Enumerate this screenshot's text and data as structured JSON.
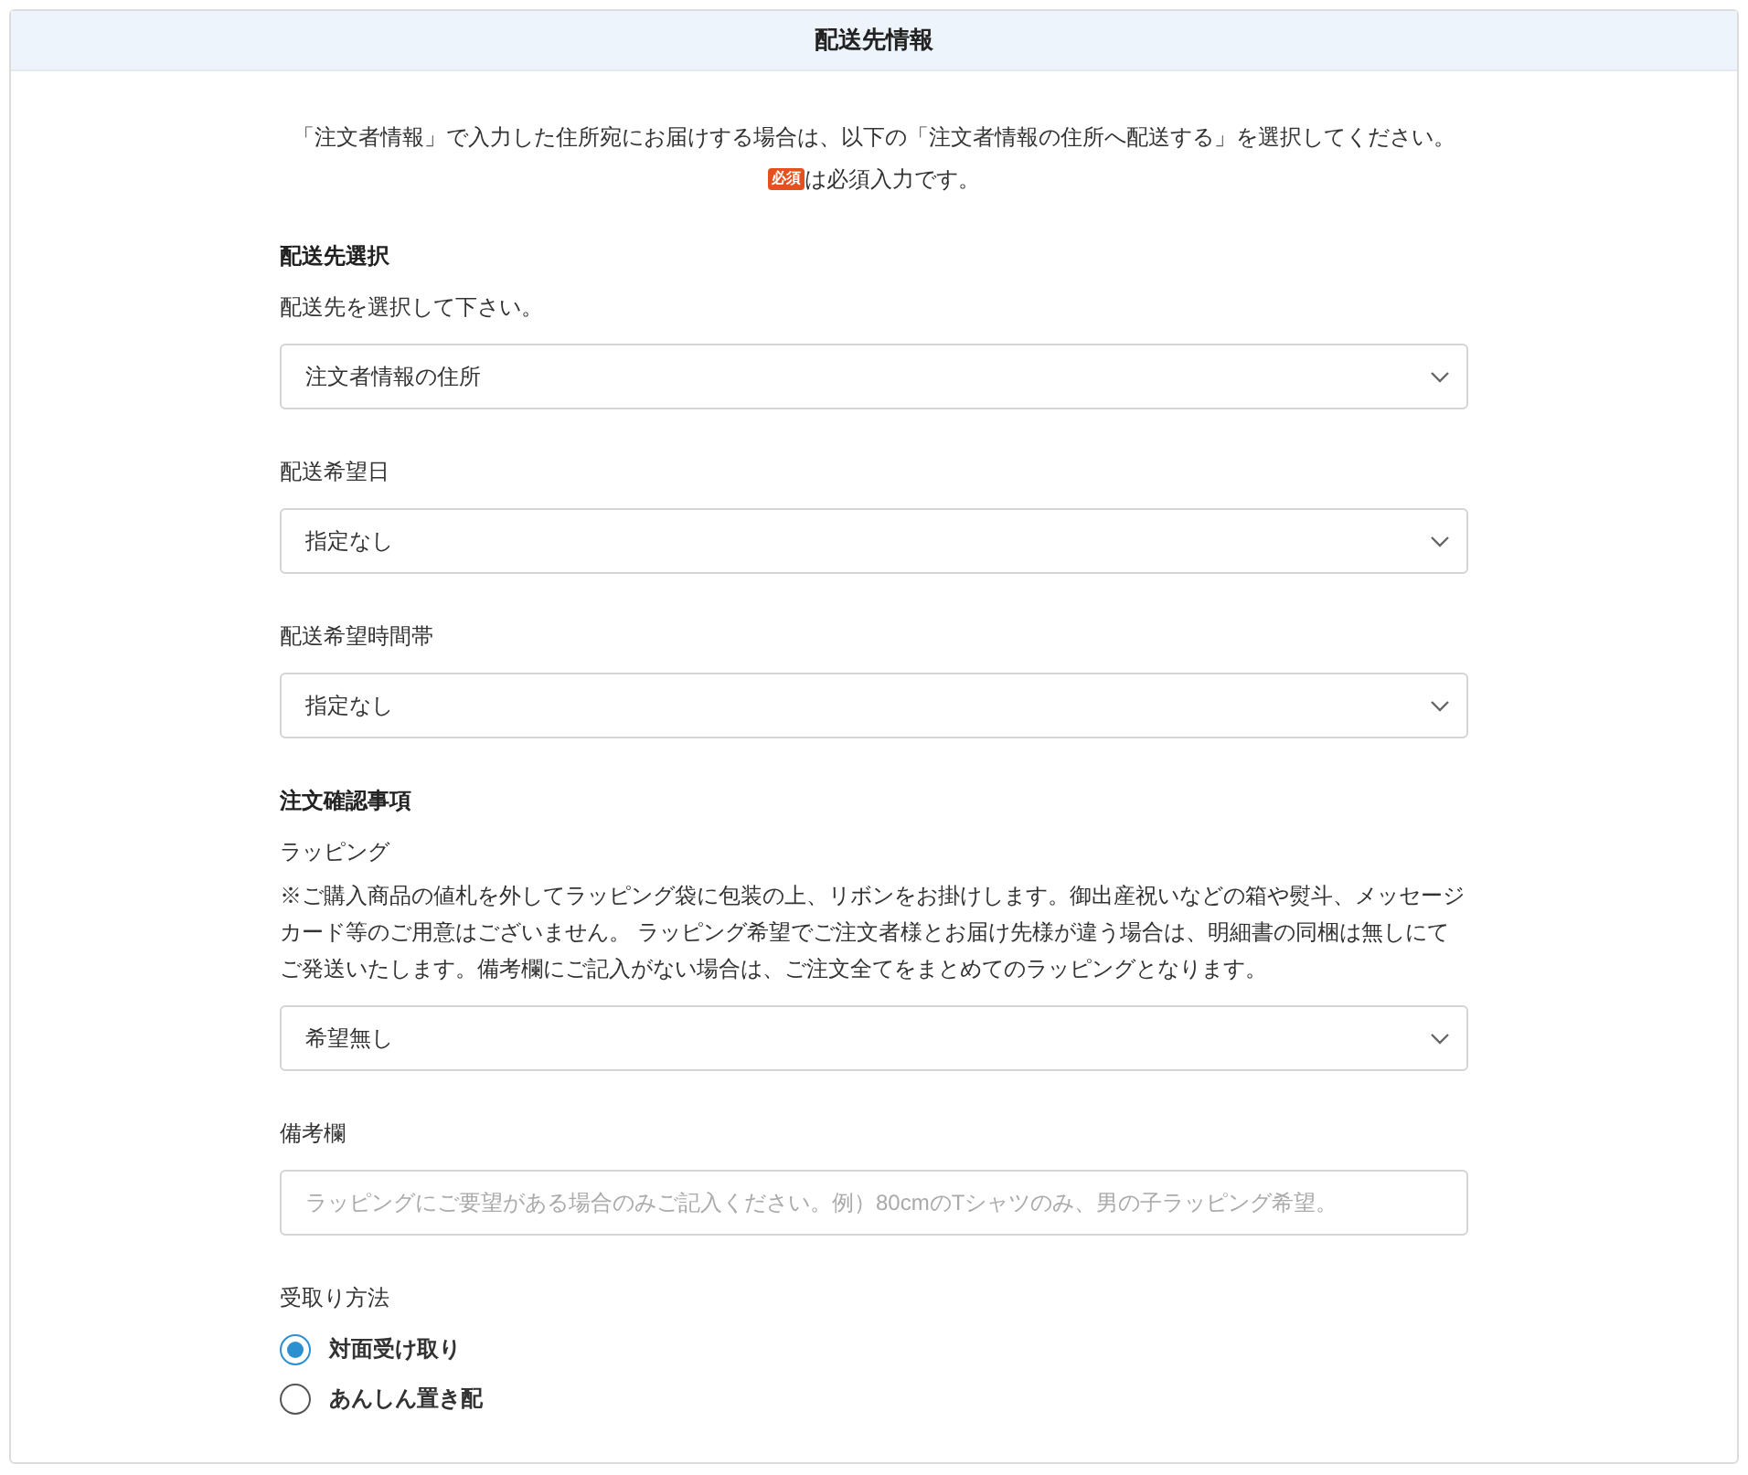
{
  "title": "配送先情報",
  "intro": "「注文者情報」で入力した住所宛にお届けする場合は、以下の「注文者情報の住所へ配送する」を選択してください。",
  "required_badge": "必須",
  "required_note": "は必須入力です。",
  "items": [
    {
      "kind": "heading",
      "text": "配送先選択"
    },
    {
      "kind": "label",
      "text": "配送先を選択して下さい。"
    },
    {
      "kind": "select",
      "value": "注文者情報の住所"
    },
    {
      "kind": "label",
      "text": "配送希望日"
    },
    {
      "kind": "select",
      "value": "指定なし"
    },
    {
      "kind": "label",
      "text": "配送希望時間帯"
    },
    {
      "kind": "select",
      "value": "指定なし"
    },
    {
      "kind": "heading",
      "text": "注文確認事項"
    },
    {
      "kind": "label",
      "text": "ラッピング"
    },
    {
      "kind": "note",
      "text": "※ご購入商品の値札を外してラッピング袋に包装の上、リボンをお掛けします。御出産祝いなどの箱や熨斗、メッセージカード等のご用意はございません。 ラッピング希望でご注文者様とお届け先様が違う場合は、明細書の同梱は無しにてご発送いたします。備考欄にご記入がない場合は、ご注文全てをまとめてのラッピングとなります。"
    },
    {
      "kind": "select",
      "value": "希望無し"
    },
    {
      "kind": "label",
      "text": "備考欄"
    },
    {
      "kind": "input",
      "placeholder": "ラッピングにご要望がある場合のみご記入ください。例）80cmのTシャツのみ、男の子ラッピング希望。"
    },
    {
      "kind": "label",
      "text": "受取り方法"
    },
    {
      "kind": "radios",
      "options": [
        {
          "label": "対面受け取り",
          "selected": true
        },
        {
          "label": "あんしん置き配",
          "selected": false
        }
      ]
    }
  ]
}
